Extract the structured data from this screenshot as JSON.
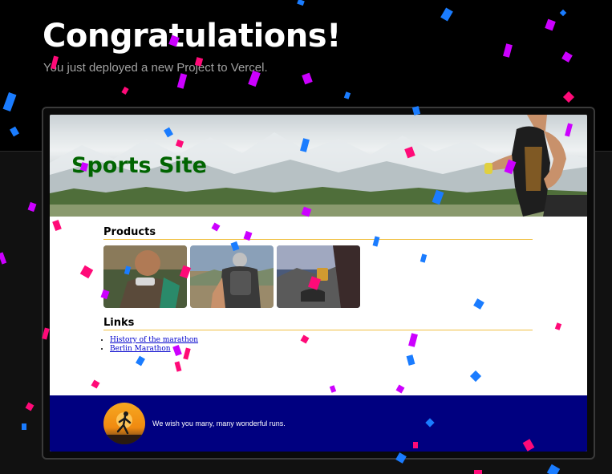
{
  "header": {
    "title": "Congratulations!",
    "subtitle": "You just deployed a new Project to Vercel."
  },
  "site": {
    "title": "Sports Site",
    "products_heading": "Products",
    "links_heading": "Links",
    "links": [
      {
        "label": "History of the marathon"
      },
      {
        "label": "Berlin Marathon"
      }
    ],
    "footer_text": "We wish you many, many wonderful runs."
  },
  "colors": {
    "site_title": "#006400",
    "footer_bg": "#000080",
    "heading_rule": "#f0c040",
    "confetti": [
      "#ff0a78",
      "#cc00ff",
      "#1a7cff"
    ]
  }
}
